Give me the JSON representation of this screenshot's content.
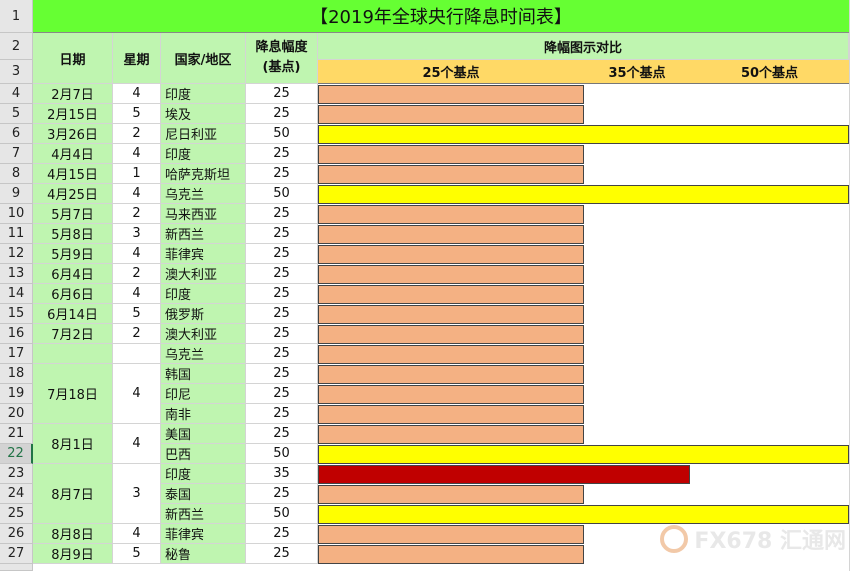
{
  "title": "【2019年全球央行降息时间表】",
  "headers": {
    "date": "日期",
    "weekday": "星期",
    "country": "国家/地区",
    "rate_cut_line1": "降息幅度",
    "rate_cut_line2": "(基点)",
    "chart_title": "降幅图示对比",
    "scale_25": "25个基点",
    "scale_35": "35个基点",
    "scale_50": "50个基点"
  },
  "row_numbers": [
    "1",
    "2",
    "3",
    "4",
    "5",
    "6",
    "7",
    "8",
    "9",
    "10",
    "11",
    "12",
    "13",
    "14",
    "15",
    "16",
    "17",
    "18",
    "19",
    "20",
    "21",
    "22",
    "23",
    "24",
    "25",
    "26",
    "27"
  ],
  "date_groups": [
    {
      "date": "2月7日",
      "weekday": "4"
    },
    {
      "date": "2月15日",
      "weekday": "5"
    },
    {
      "date": "3月26日",
      "weekday": "2"
    },
    {
      "date": "4月4日",
      "weekday": "4"
    },
    {
      "date": "4月15日",
      "weekday": "1"
    },
    {
      "date": "4月25日",
      "weekday": "4"
    },
    {
      "date": "5月7日",
      "weekday": "2"
    },
    {
      "date": "5月8日",
      "weekday": "3"
    },
    {
      "date": "5月9日",
      "weekday": "4"
    },
    {
      "date": "6月4日",
      "weekday": "2"
    },
    {
      "date": "6月6日",
      "weekday": "4"
    },
    {
      "date": "6月14日",
      "weekday": "5"
    },
    {
      "date": "7月2日",
      "weekday": "2"
    },
    {
      "date": "",
      "weekday": ""
    },
    {
      "date": "7月18日",
      "weekday": "4"
    },
    {
      "date": "8月1日",
      "weekday": "4"
    },
    {
      "date": "8月7日",
      "weekday": "3"
    },
    {
      "date": "8月8日",
      "weekday": "4"
    },
    {
      "date": "8月9日",
      "weekday": "5"
    }
  ],
  "rows": [
    {
      "country": "印度",
      "bps": "25"
    },
    {
      "country": "埃及",
      "bps": "25"
    },
    {
      "country": "尼日利亚",
      "bps": "50"
    },
    {
      "country": "印度",
      "bps": "25"
    },
    {
      "country": "哈萨克斯坦",
      "bps": "25"
    },
    {
      "country": "乌克兰",
      "bps": "50"
    },
    {
      "country": "马来西亚",
      "bps": "25"
    },
    {
      "country": "新西兰",
      "bps": "25"
    },
    {
      "country": "菲律宾",
      "bps": "25"
    },
    {
      "country": "澳大利亚",
      "bps": "25"
    },
    {
      "country": "印度",
      "bps": "25"
    },
    {
      "country": "俄罗斯",
      "bps": "25"
    },
    {
      "country": "澳大利亚",
      "bps": "25"
    },
    {
      "country": "乌克兰",
      "bps": "25"
    },
    {
      "country": "韩国",
      "bps": "25"
    },
    {
      "country": "印尼",
      "bps": "25"
    },
    {
      "country": "南非",
      "bps": "25"
    },
    {
      "country": "美国",
      "bps": "25"
    },
    {
      "country": "巴西",
      "bps": "50"
    },
    {
      "country": "印度",
      "bps": "35"
    },
    {
      "country": "泰国",
      "bps": "25"
    },
    {
      "country": "新西兰",
      "bps": "50"
    },
    {
      "country": "菲律宾",
      "bps": "25"
    },
    {
      "country": "秘鲁",
      "bps": "25"
    }
  ],
  "colors": {
    "title_bg": "#66ff33",
    "label_bg": "#bff5b0",
    "scale_bg": "#ffd966",
    "bar_25": "#f4b183",
    "bar_35": "#c00000",
    "bar_50": "#ffff00"
  },
  "watermark": "FX678 汇通网"
}
